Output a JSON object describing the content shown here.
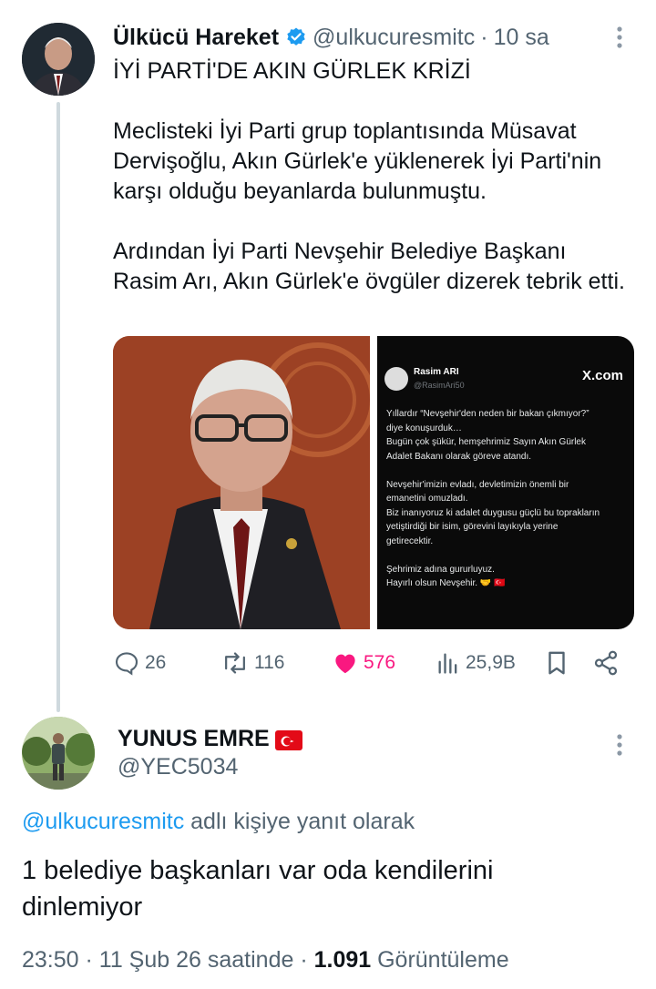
{
  "tweet1": {
    "author_name": "Ülkücü Hareket",
    "handle": "@ulkucuresmitc",
    "separator": "·",
    "time": "10 sa",
    "title": "İYİ PARTİ'DE AKIN GÜRLEK KRİZİ",
    "paragraph1": "Meclisteki İyi Parti grup toplantısında Müsavat Dervişoğlu, Akın Gürlek'e yüklenerek İyi Parti'nin karşı olduğu beyanlarda bulunmuştu.",
    "paragraph2": "Ardından İyi Parti Nevşehir Belediye Başkanı Rasim Arı, Akın Gürlek'e övgüler dizerek tebrik etti.",
    "embedded_post": {
      "name": "Rasim ARI",
      "handle": "@RasimAri50",
      "logo": "X.com",
      "text": "Yıllardır “Nevşehir'den neden bir bakan çıkmıyor?”\ndiye konuşurduk…\nBugün çok şükür, hemşehrimiz Sayın Akın Gürlek\nAdalet Bakanı olarak göreve atandı.\n\nNevşehir'imizin evladı, devletimizin önemli bir\nemanetini omuzladı.\nBiz inanıyoruz ki adalet duygusu güçlü bu toprakların\nyetiştirdiği bir isim, görevini layıkıyla yerine\ngetirecektir.\n\nŞehrimiz adına gururluyuz.\nHayırlı olsun Nevşehir. 🤝 🇹🇷"
    },
    "actions": {
      "replies": "26",
      "reposts": "116",
      "likes": "576",
      "views": "25,9B"
    }
  },
  "tweet2": {
    "author_name": "YUNUS EMRE",
    "handle": "@YEC5034",
    "reply_mention": "@ulkucuresmitc",
    "reply_suffix": " adlı kişiye yanıt olarak",
    "body": "1 belediye başkanları var oda kendilerini dinlemiyor",
    "meta_time": "23:50 · 11 Şub 26 saatinde · ",
    "meta_views": "1.091",
    "meta_views_label": " Görüntüleme"
  },
  "colors": {
    "text": "#0f1419",
    "secondary": "#536471",
    "accent": "#1d9bf0",
    "like": "#f91880",
    "thread_line": "#cfd9de"
  },
  "icons": [
    "verified-badge-icon",
    "more-icon",
    "reply-icon",
    "repost-icon",
    "heart-icon",
    "views-icon",
    "bookmark-icon",
    "share-icon",
    "turkey-flag-icon"
  ]
}
